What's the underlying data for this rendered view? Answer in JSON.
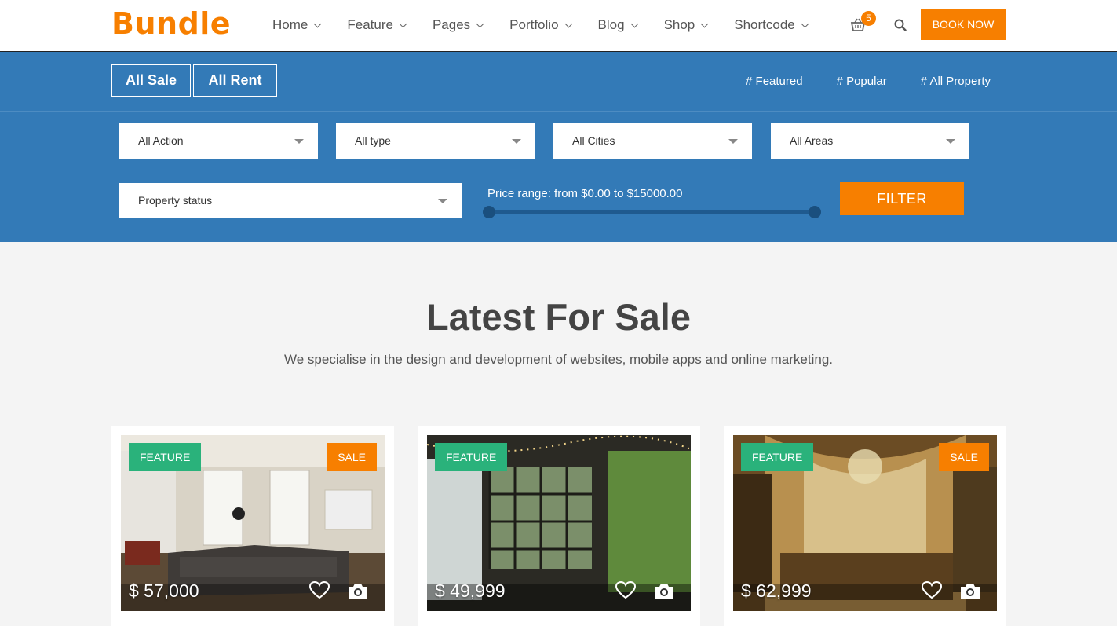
{
  "brand": {
    "logo": "Bundle"
  },
  "nav": {
    "items": [
      {
        "label": "Home"
      },
      {
        "label": "Feature"
      },
      {
        "label": "Pages"
      },
      {
        "label": "Portfolio"
      },
      {
        "label": "Blog"
      },
      {
        "label": "Shop"
      },
      {
        "label": "Shortcode"
      }
    ],
    "cart_count": "5",
    "book_label": "BOOK NOW"
  },
  "search": {
    "tabs": [
      "All Sale",
      "All Rent"
    ],
    "links": [
      "# Featured",
      "# Popular",
      "# All Property"
    ],
    "selects": {
      "action": "All Action",
      "type": "All type",
      "cities": "All Cities",
      "areas": "All Areas",
      "status": "Property status"
    },
    "price_range": "Price range: from $0.00 to $15000.00",
    "price_min_fraction": 0.0,
    "price_max_fraction": 1.0,
    "filter_label": "FILTER"
  },
  "section": {
    "title": "Latest For Sale",
    "subtitle": "We specialise in the design and development of websites, mobile apps and online marketing."
  },
  "listings": [
    {
      "feature": "FEATURE",
      "sale": "SALE",
      "price": "$ 57,000"
    },
    {
      "feature": "FEATURE",
      "sale": "",
      "price": "$ 49,999"
    },
    {
      "feature": "FEATURE",
      "sale": "SALE",
      "price": "$ 62,999"
    }
  ],
  "colors": {
    "accent": "#f77f00",
    "band": "#337ab7",
    "feature_badge": "#2ab27b"
  }
}
